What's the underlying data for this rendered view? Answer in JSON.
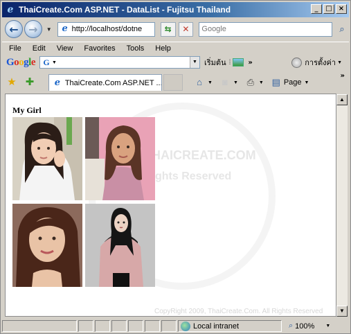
{
  "window": {
    "title": "ThaiCreate.Com ASP.NET - DataList - Fujitsu Thailand"
  },
  "address_bar": {
    "url": "http://localhost/dotne"
  },
  "search": {
    "placeholder": "Google"
  },
  "menu": [
    "File",
    "Edit",
    "View",
    "Favorites",
    "Tools",
    "Help"
  ],
  "google_toolbar": {
    "logo": "Google",
    "search_label": "เริ่มต้น",
    "settings_label": "การตั้งค่า"
  },
  "tab": {
    "title": "ThaiCreate.Com ASP.NET ..."
  },
  "commands": {
    "page": "Page"
  },
  "content": {
    "heading": "My Girl",
    "copyright": "CopyRight 2009, ThaiCreate.Com. All Rights Reserved",
    "watermark_line1": "THAICREATE.COM",
    "watermark_line2": "Rights Reserved"
  },
  "status": {
    "zone": "Local intranet",
    "zoom": "100%"
  },
  "icons": {
    "back": "back-arrow-icon",
    "forward": "forward-arrow-icon",
    "refresh": "refresh-icon",
    "stop": "stop-icon",
    "search": "search-icon",
    "favorites": "star-icon",
    "add_favorites": "add-favorite-icon",
    "home": "home-icon",
    "feeds": "rss-icon",
    "print": "printer-icon",
    "page": "page-icon"
  }
}
